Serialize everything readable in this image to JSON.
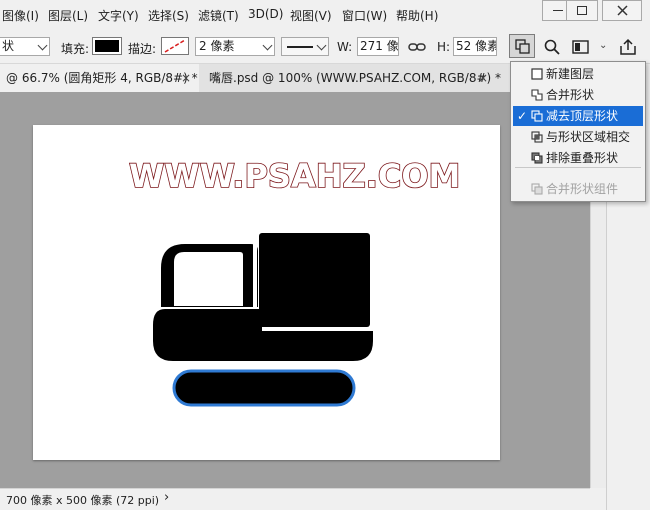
{
  "menubar": {
    "items": [
      "图像(I)",
      "图层(L)",
      "文字(Y)",
      "选择(S)",
      "滤镜(T)",
      "3D(D)",
      "视图(V)",
      "窗口(W)",
      "帮助(H)"
    ]
  },
  "options": {
    "shape_mode": "状",
    "fill_label": "填充:",
    "fill_color": "#000000",
    "stroke_label": "描边:",
    "stroke_width": "2 像素",
    "w_label": "W:",
    "w_value": "271 像:",
    "h_label": "H:",
    "h_value": "52 像素"
  },
  "tabs": [
    {
      "label": "@ 66.7% (圆角矩形 4, RGB/8#) *",
      "close": "×"
    },
    {
      "label": "嘴唇.psd @ 100% (WWW.PSAHZ.COM, RGB/8#) *",
      "close": "×"
    }
  ],
  "canvas": {
    "watermark": "WWW.PSAHZ.COM",
    "watermark_stroke_color": "#7a1418",
    "shape_fill": "#000000",
    "selection_stroke_color": "#2f7ad3"
  },
  "status": {
    "doc_size": "700 像素 x 500 像素 (72 ppi)",
    "arrow": "›"
  },
  "path_ops_menu": {
    "items": [
      {
        "label": "新建图层",
        "icon": "new-layer-icon",
        "selected": false,
        "disabled": false
      },
      {
        "label": "合并形状",
        "icon": "combine-shapes-icon",
        "selected": false,
        "disabled": false
      },
      {
        "label": "减去顶层形状",
        "icon": "subtract-front-shape-icon",
        "selected": true,
        "disabled": false
      },
      {
        "label": "与形状区域相交",
        "icon": "intersect-shapes-icon",
        "selected": false,
        "disabled": false
      },
      {
        "label": "排除重叠形状",
        "icon": "exclude-overlap-icon",
        "selected": false,
        "disabled": false
      },
      {
        "label": "合并形状组件",
        "icon": "merge-components-icon",
        "selected": false,
        "disabled": true
      }
    ],
    "checkmark": "✓"
  }
}
